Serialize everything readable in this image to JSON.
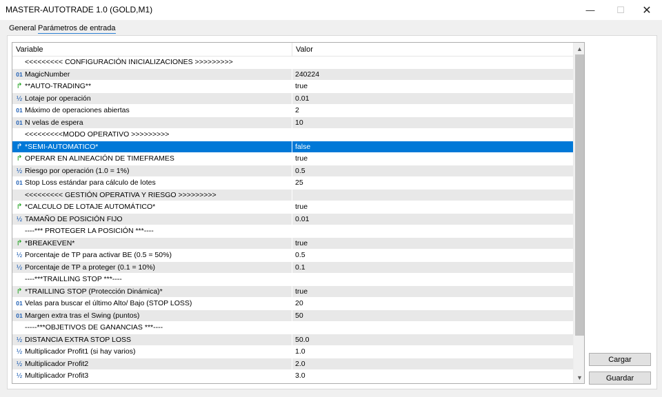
{
  "window": {
    "title": "MASTER-AUTOTRADE 1.0 (GOLD,M1)",
    "minimize_glyph": "—",
    "maximize_glyph": "☐",
    "close_glyph": "✕"
  },
  "tabs": [
    {
      "label": "General",
      "active": false
    },
    {
      "label": "Parámetros de entrada",
      "active": true
    }
  ],
  "grid": {
    "columns": [
      "Variable",
      "Valor"
    ],
    "selected_index": 7,
    "rows": [
      {
        "icon": "",
        "name": "<<<<<<<<< CONFIGURACIÓN INICIALIZACIONES >>>>>>>>>",
        "value": ""
      },
      {
        "icon": "int-icon",
        "name": "MagicNumber",
        "value": "240224"
      },
      {
        "icon": "bool-icon",
        "name": "**AUTO-TRADING**",
        "value": "true"
      },
      {
        "icon": "double-icon",
        "name": "Lotaje por operación",
        "value": "0.01"
      },
      {
        "icon": "int-icon",
        "name": "Máximo de operaciones abiertas",
        "value": "2"
      },
      {
        "icon": "int-icon",
        "name": "N velas de espera",
        "value": "10"
      },
      {
        "icon": "",
        "name": "<<<<<<<<<MODO OPERATIVO >>>>>>>>>",
        "value": ""
      },
      {
        "icon": "bool-icon",
        "name": "*SEMI-AUTOMATICO*",
        "value": "false"
      },
      {
        "icon": "bool-icon",
        "name": "OPERAR EN ALINEACIÓN DE TIMEFRAMES",
        "value": "true"
      },
      {
        "icon": "double-icon",
        "name": "Riesgo por operación (1.0 = 1%)",
        "value": "0.5"
      },
      {
        "icon": "int-icon",
        "name": "Stop Loss estándar para cálculo de lotes",
        "value": "25"
      },
      {
        "icon": "",
        "name": "<<<<<<<<< GESTIÓN OPERATIVA Y RIESGO >>>>>>>>>",
        "value": ""
      },
      {
        "icon": "bool-icon",
        "name": "*CALCULO DE LOTAJE AUTOMÁTICO*",
        "value": "true"
      },
      {
        "icon": "double-icon",
        "name": "TAMAÑO DE POSICIÓN FIJO",
        "value": "0.01"
      },
      {
        "icon": "",
        "name": "----*** PROTEGER LA POSICIÓN ***----",
        "value": ""
      },
      {
        "icon": "bool-icon",
        "name": "*BREAKEVEN*",
        "value": "true"
      },
      {
        "icon": "double-icon",
        "name": "Porcentaje de TP para activar BE (0.5 = 50%)",
        "value": "0.5"
      },
      {
        "icon": "double-icon",
        "name": "Porcentaje de TP a proteger (0.1 = 10%)",
        "value": "0.1"
      },
      {
        "icon": "",
        "name": "----***TRAILLING STOP ***----",
        "value": ""
      },
      {
        "icon": "bool-icon",
        "name": "*TRAILLING STOP (Protección Dinámica)*",
        "value": "true"
      },
      {
        "icon": "int-icon",
        "name": "Velas para buscar el último Alto/ Bajo (STOP LOSS)",
        "value": "20"
      },
      {
        "icon": "int-icon",
        "name": "Margen extra tras el Swing (puntos)",
        "value": "50"
      },
      {
        "icon": "",
        "name": "-----***OBJETIVOS DE GANANCIAS ***----",
        "value": ""
      },
      {
        "icon": "double-icon",
        "name": "DISTANCIA EXTRA STOP LOSS",
        "value": "50.0"
      },
      {
        "icon": "double-icon",
        "name": "Multiplicador Profit1 (si hay varios)",
        "value": "1.0"
      },
      {
        "icon": "double-icon",
        "name": "Multiplicador Profit2",
        "value": "2.0"
      },
      {
        "icon": "double-icon",
        "name": "Multiplicador Profit3",
        "value": "3.0"
      }
    ]
  },
  "icon_glyphs": {
    "int-icon": "01",
    "bool-icon": "↱",
    "double-icon": "½"
  },
  "scrollbar": {
    "up_glyph": "▲",
    "down_glyph": "▼"
  },
  "buttons": {
    "load": "Cargar",
    "save": "Guardar"
  },
  "colors": {
    "selection": "#0078d7",
    "bool_icon": "#18a018",
    "int_icon": "#1f5fb4"
  }
}
